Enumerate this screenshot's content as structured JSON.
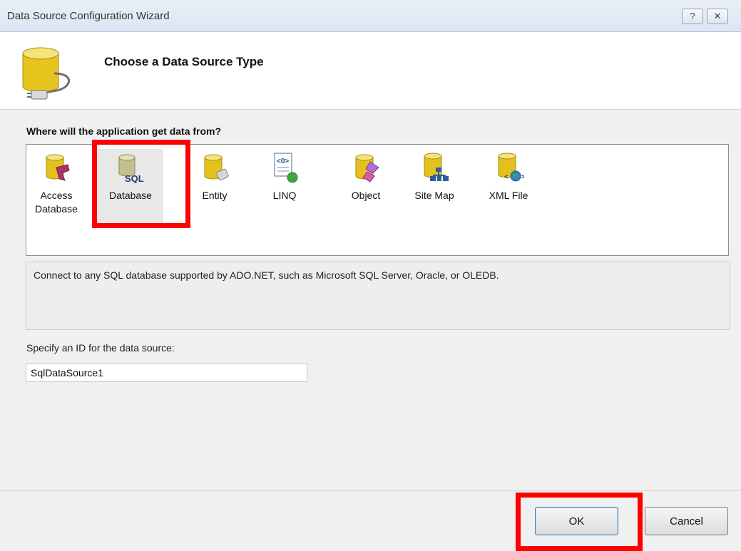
{
  "window": {
    "title": "Data Source Configuration Wizard",
    "help_label": "?",
    "close_label": "✕"
  },
  "header": {
    "title": "Choose a Data Source Type"
  },
  "source_section": {
    "label": "Where will the application get data from?",
    "items": [
      {
        "label": "Access Database",
        "icon": "access-database-icon"
      },
      {
        "label": "Database",
        "icon": "sql-database-icon",
        "selected": true,
        "icon_text": "SQL"
      },
      {
        "label": "Entity",
        "icon": "entity-icon"
      },
      {
        "label": "LINQ",
        "icon": "linq-icon"
      },
      {
        "label": "Object",
        "icon": "object-icon"
      },
      {
        "label": "Site Map",
        "icon": "site-map-icon"
      },
      {
        "label": "XML File",
        "icon": "xml-file-icon"
      }
    ]
  },
  "description": "Connect to any SQL database supported by ADO.NET, such as Microsoft SQL Server, Oracle, or OLEDB.",
  "id_section": {
    "label": "Specify an ID for the data source:",
    "value": "SqlDataSource1"
  },
  "buttons": {
    "ok": "OK",
    "cancel": "Cancel"
  },
  "colors": {
    "highlight": "#ff0000",
    "cylinder": "#e3c21f"
  }
}
